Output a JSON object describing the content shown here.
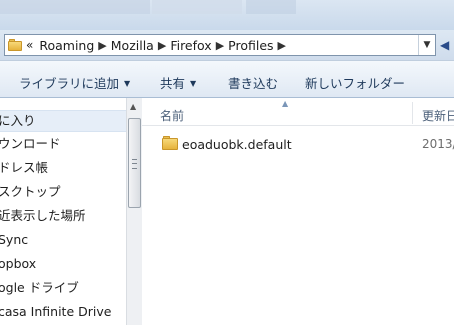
{
  "address": {
    "prefix": "«",
    "crumbs": [
      "Roaming",
      "Mozilla",
      "Firefox",
      "Profiles"
    ],
    "separator": "▶"
  },
  "toolbar": {
    "library_label": "ライブラリに追加",
    "share_label": "共有",
    "burn_label": "書き込む",
    "new_folder_label": "新しいフォルダー"
  },
  "nav": {
    "items": [
      "に入り",
      "ウンロード",
      "ドレス帳",
      "スクトップ",
      "近表示した場所",
      "Sync",
      "opbox",
      "ogle ドライブ",
      "casa Infinite Drive"
    ]
  },
  "columns": {
    "name": "名前",
    "date": "更新日"
  },
  "files": [
    {
      "name": "eoaduobk.default",
      "date": "2013/"
    }
  ],
  "colors": {
    "accent": "#1e395b",
    "toolbar_bg": "#dfe8f3",
    "selection": "#e6eef8"
  }
}
